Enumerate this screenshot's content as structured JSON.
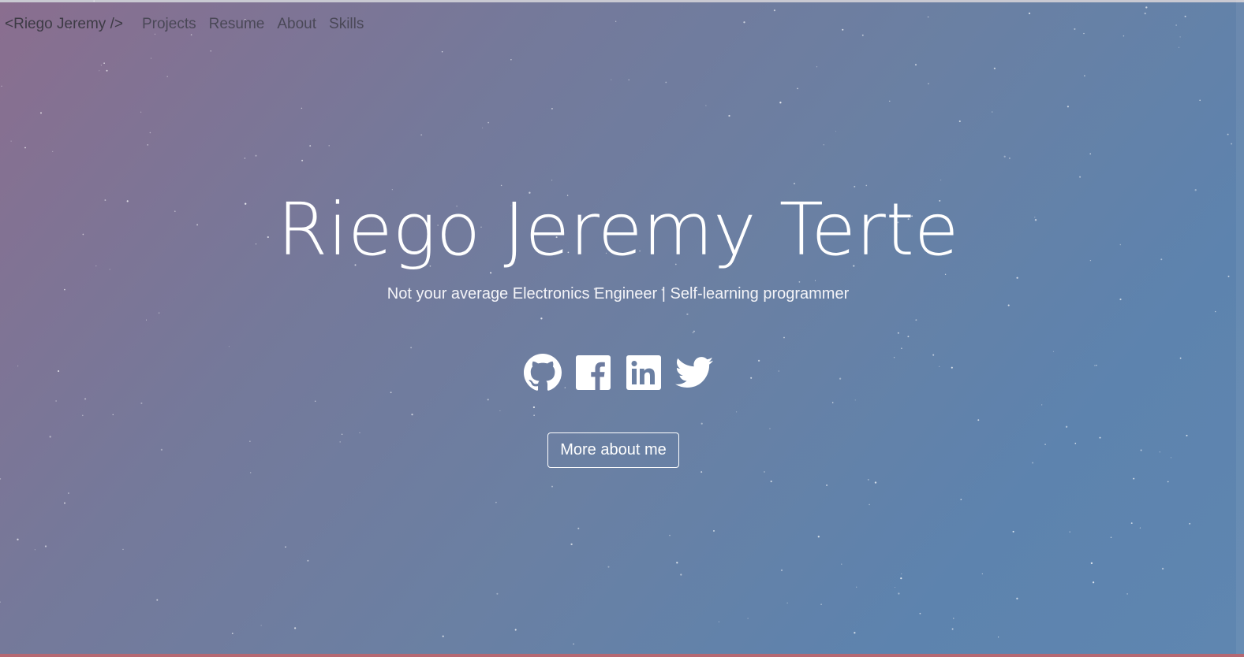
{
  "nav": {
    "brand": "<Riego Jeremy />",
    "links": [
      "Projects",
      "Resume",
      "About",
      "Skills"
    ]
  },
  "hero": {
    "title": "Riego Jeremy Terte",
    "tagline": "Not your average Electronics Engineer | Self-learning programmer",
    "cta": "More about me"
  },
  "socials": [
    {
      "name": "github-icon"
    },
    {
      "name": "facebook-icon"
    },
    {
      "name": "linkedin-icon"
    },
    {
      "name": "twitter-icon"
    }
  ],
  "colors": {
    "gradient_start": "#8a6e8f",
    "gradient_end": "#5f86b0",
    "text": "#ffffff",
    "nav_text": "#4a4857"
  }
}
